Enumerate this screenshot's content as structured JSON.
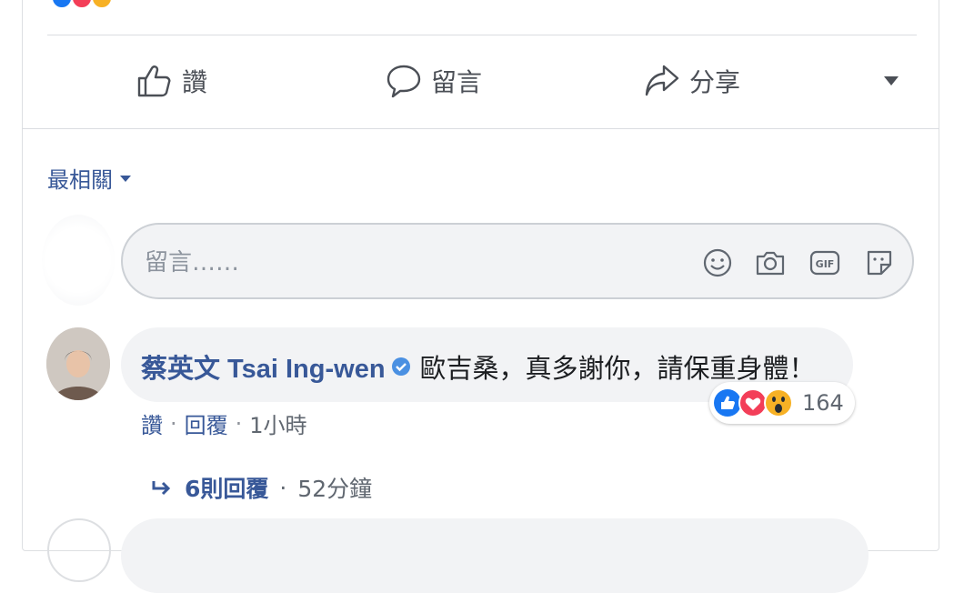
{
  "actions": {
    "like_label": "讚",
    "comment_label": "留言",
    "share_label": "分享"
  },
  "sort": {
    "label": "最相關"
  },
  "composer": {
    "placeholder": "留言……"
  },
  "comment": {
    "author": "蔡英文 Tsai Ing-wen",
    "text": "歐吉桑，真多謝你，請保重身體！",
    "reaction_count": "164",
    "like_label": "讚",
    "reply_label": "回覆",
    "time": "1小時",
    "replies_label": "6則回覆",
    "replies_time": "52分鐘"
  },
  "colors": {
    "link": "#385898",
    "like_blue": "#1877f2",
    "love_red": "#f33e58",
    "wow_yellow": "#f7b125"
  }
}
